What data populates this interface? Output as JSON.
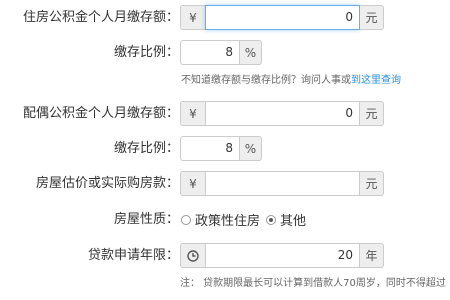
{
  "housing_fund_monthly": {
    "label": "住房公积金个人月缴存额：",
    "currency": "¥",
    "value": "0",
    "unit": "元"
  },
  "housing_fund_ratio": {
    "label": "缴存比例：",
    "value": "8",
    "unit": "%"
  },
  "hint": {
    "text": "不知道缴存额与缴存比例？询问人事或",
    "link": "到这里查询"
  },
  "spouse_fund_monthly": {
    "label": "配偶公积金个人月缴存额：",
    "currency": "¥",
    "value": "0",
    "unit": "元"
  },
  "spouse_fund_ratio": {
    "label": "缴存比例：",
    "value": "8",
    "unit": "%"
  },
  "house_price": {
    "label": "房屋估价或实际购房款：",
    "currency": "¥",
    "value": "",
    "unit": "元"
  },
  "house_type": {
    "label": "房屋性质：",
    "options": [
      "政策性住房",
      "其他"
    ],
    "selected": "其他"
  },
  "loan_years": {
    "label": "贷款申请年限：",
    "icon": "clock-icon",
    "value": "20",
    "unit": "年"
  },
  "note": {
    "text": "注： 贷款期限最长可以计算到借款人70周岁，同时不得超过"
  }
}
